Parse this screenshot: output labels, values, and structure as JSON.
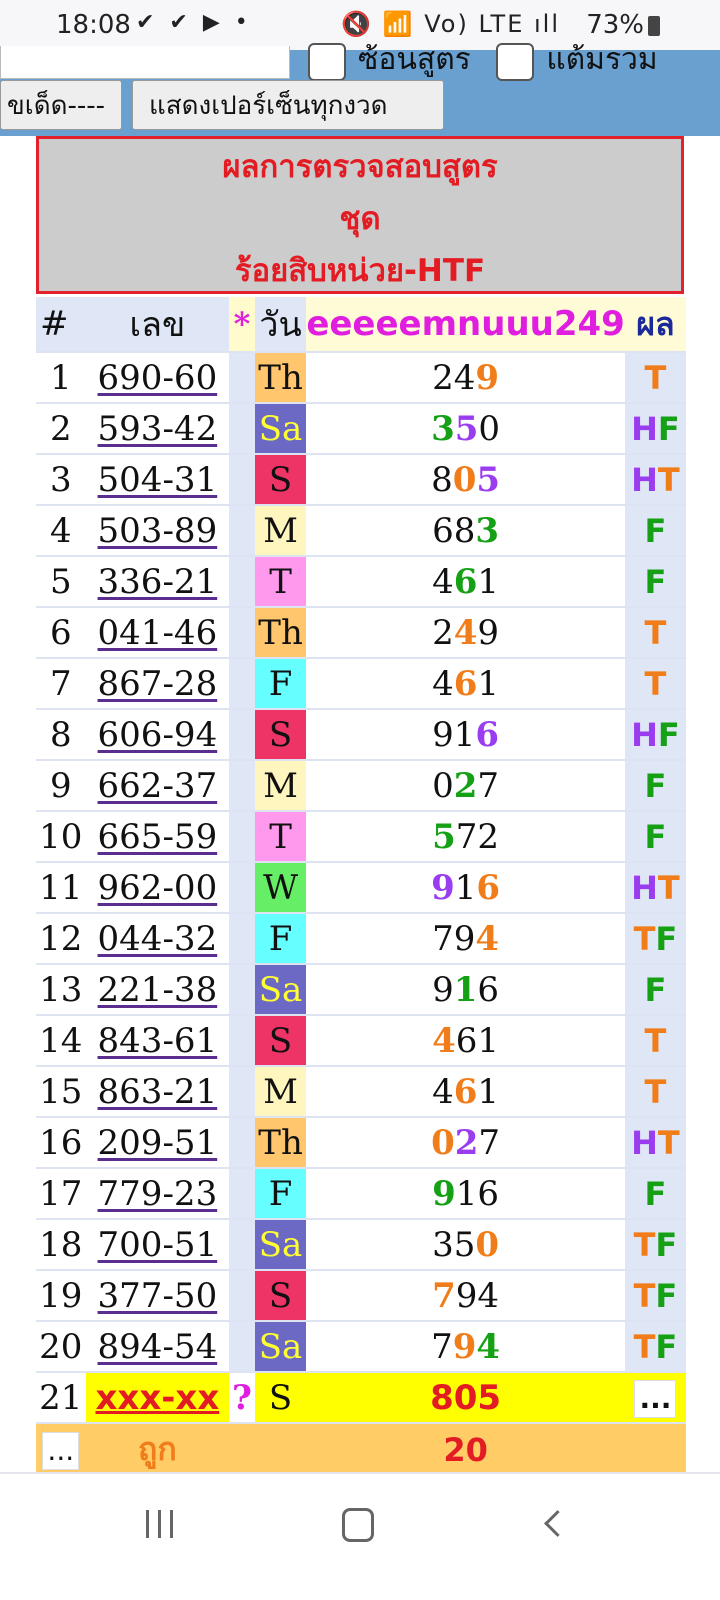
{
  "status": {
    "time": "18:08",
    "left_icons": "✔ ✔ ▶ •",
    "right_icons": "🔇 📶 Vo) LTE ıll",
    "battery": "73%"
  },
  "controls": {
    "checkbox1_label": "ซ้อนสูตร",
    "checkbox2_label": "แต้มรวม",
    "button1_label": "ขเด็ด----",
    "button2_label": "แสดงเปอร์เซ็นทุกงวด"
  },
  "title": {
    "line1": "ผลการตรวจสอบสูตร",
    "line2": "ชุด",
    "line3": "ร้อยสิบหน่วย-HTF"
  },
  "table": {
    "headers": {
      "num": "#",
      "lek": "เลข",
      "star": "*",
      "day": "วัน",
      "formula": "eeeeemnuuu249",
      "result": "ผล"
    },
    "rows": [
      {
        "n": "1",
        "lek": "690-60",
        "day": "Th",
        "d": [
          "2",
          "4",
          "9"
        ],
        "dc": [
          "k",
          "k",
          "o"
        ],
        "res": "T"
      },
      {
        "n": "2",
        "lek": "593-42",
        "day": "Sa",
        "d": [
          "3",
          "5",
          "0"
        ],
        "dc": [
          "g",
          "p",
          "k"
        ],
        "res": "HF"
      },
      {
        "n": "3",
        "lek": "504-31",
        "day": "S",
        "d": [
          "8",
          "0",
          "5"
        ],
        "dc": [
          "k",
          "o",
          "p"
        ],
        "res": "HT"
      },
      {
        "n": "4",
        "lek": "503-89",
        "day": "M",
        "d": [
          "6",
          "8",
          "3"
        ],
        "dc": [
          "k",
          "k",
          "g"
        ],
        "res": "F"
      },
      {
        "n": "5",
        "lek": "336-21",
        "day": "T",
        "d": [
          "4",
          "6",
          "1"
        ],
        "dc": [
          "k",
          "g",
          "k"
        ],
        "res": "F"
      },
      {
        "n": "6",
        "lek": "041-46",
        "day": "Th",
        "d": [
          "2",
          "4",
          "9"
        ],
        "dc": [
          "k",
          "o",
          "k"
        ],
        "res": "T"
      },
      {
        "n": "7",
        "lek": "867-28",
        "day": "F",
        "d": [
          "4",
          "6",
          "1"
        ],
        "dc": [
          "k",
          "o",
          "k"
        ],
        "res": "T"
      },
      {
        "n": "8",
        "lek": "606-94",
        "day": "S",
        "d": [
          "9",
          "1",
          "6"
        ],
        "dc": [
          "k",
          "k",
          "p"
        ],
        "res": "HF"
      },
      {
        "n": "9",
        "lek": "662-37",
        "day": "M",
        "d": [
          "0",
          "2",
          "7"
        ],
        "dc": [
          "k",
          "g",
          "k"
        ],
        "res": "F"
      },
      {
        "n": "10",
        "lek": "665-59",
        "day": "T",
        "d": [
          "5",
          "7",
          "2"
        ],
        "dc": [
          "g",
          "k",
          "k"
        ],
        "res": "F"
      },
      {
        "n": "11",
        "lek": "962-00",
        "day": "W",
        "d": [
          "9",
          "1",
          "6"
        ],
        "dc": [
          "p",
          "k",
          "o"
        ],
        "res": "HT"
      },
      {
        "n": "12",
        "lek": "044-32",
        "day": "F",
        "d": [
          "7",
          "9",
          "4"
        ],
        "dc": [
          "k",
          "k",
          "o"
        ],
        "res": "TF"
      },
      {
        "n": "13",
        "lek": "221-38",
        "day": "Sa",
        "d": [
          "9",
          "1",
          "6"
        ],
        "dc": [
          "k",
          "g",
          "k"
        ],
        "res": "F"
      },
      {
        "n": "14",
        "lek": "843-61",
        "day": "S",
        "d": [
          "4",
          "6",
          "1"
        ],
        "dc": [
          "o",
          "k",
          "k"
        ],
        "res": "T"
      },
      {
        "n": "15",
        "lek": "863-21",
        "day": "M",
        "d": [
          "4",
          "6",
          "1"
        ],
        "dc": [
          "k",
          "o",
          "k"
        ],
        "res": "T"
      },
      {
        "n": "16",
        "lek": "209-51",
        "day": "Th",
        "d": [
          "0",
          "2",
          "7"
        ],
        "dc": [
          "o",
          "p",
          "k"
        ],
        "res": "HT"
      },
      {
        "n": "17",
        "lek": "779-23",
        "day": "F",
        "d": [
          "9",
          "1",
          "6"
        ],
        "dc": [
          "g",
          "k",
          "k"
        ],
        "res": "F"
      },
      {
        "n": "18",
        "lek": "700-51",
        "day": "Sa",
        "d": [
          "3",
          "5",
          "0"
        ],
        "dc": [
          "k",
          "k",
          "o"
        ],
        "res": "TF"
      },
      {
        "n": "19",
        "lek": "377-50",
        "day": "S",
        "d": [
          "7",
          "9",
          "4"
        ],
        "dc": [
          "o",
          "k",
          "k"
        ],
        "res": "TF"
      },
      {
        "n": "20",
        "lek": "894-54",
        "day": "Sa",
        "d": [
          "7",
          "9",
          "4"
        ],
        "dc": [
          "k",
          "o",
          "g"
        ],
        "res": "TF"
      }
    ],
    "pending": {
      "n": "21",
      "lek": "xxx-xx",
      "star": "?",
      "day": "S",
      "formula": "805",
      "result": "..."
    },
    "summary": {
      "dots": "...",
      "label": "ถูก",
      "value": "20"
    }
  },
  "colors": {
    "title_red": "#e31b23",
    "formula_magenta": "#e01ee0",
    "hit_green": "#15a015",
    "hit_orange": "#f07d1a",
    "hit_purple": "#9a3cf0",
    "pending_yellow": "#ffff00",
    "summary_orange_bg": "#ffcc66"
  },
  "nav": {
    "recent": "recent-apps-icon",
    "home": "home-icon",
    "back": "back-icon"
  }
}
